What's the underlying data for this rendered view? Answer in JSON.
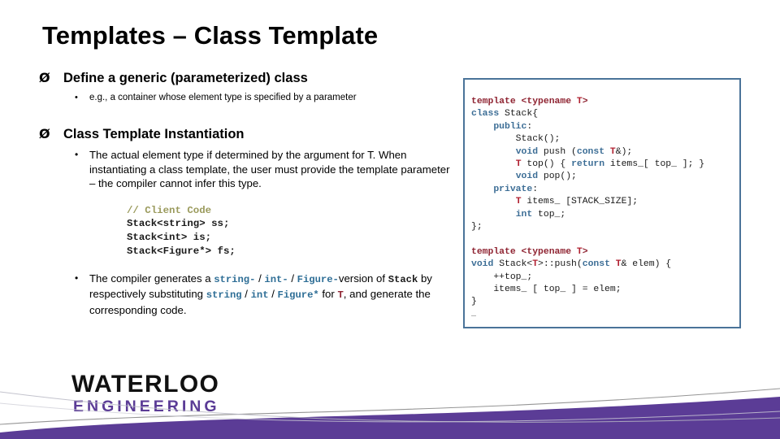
{
  "slide": {
    "title": "Templates – Class Template",
    "bullets": [
      {
        "marker": "Ø",
        "text": "Define a generic (parameterized) class",
        "sub": [
          {
            "marker": "•",
            "text": "e.g., a container whose element type is specified by a parameter"
          }
        ]
      },
      {
        "marker": "Ø",
        "text": "Class Template Instantiation",
        "sub": [
          {
            "marker": "•",
            "text": "The actual element type if determined by the argument for T. When instantiating a class template, the user must provide the template parameter – the compiler cannot infer this type."
          }
        ]
      }
    ],
    "client_code": {
      "comment": "// Client Code",
      "lines": [
        "Stack<string> ss;",
        "Stack<int> is;",
        "Stack<Figure*> fs;"
      ]
    },
    "compiler_bullet": {
      "marker": "•",
      "prefix": "The compiler generates a ",
      "type_a": "string-",
      "sep1": " / ",
      "type_b": "int-",
      "sep2": " / ",
      "type_c": "Figure-",
      "mid1": "version of ",
      "stack_token": "Stack",
      "mid2": " by respectively substituting",
      "sub_a": "string",
      "sep3": " / ",
      "sub_b": "int",
      "sep4": " / ",
      "sub_c": "Figure*",
      "mid3": " for ",
      "t_token": "T",
      "tail": ", and generate the corresponding code."
    },
    "code_box": {
      "lines": [
        [
          {
            "t": "template ",
            "c": "tmpl"
          },
          {
            "t": "<",
            "c": "tmpl"
          },
          {
            "t": "typename ",
            "c": "tmpl"
          },
          {
            "t": "T",
            "c": "tparam"
          },
          {
            "t": ">",
            "c": "tmpl"
          }
        ],
        [
          {
            "t": "class ",
            "c": "kw"
          },
          {
            "t": "Stack{",
            "c": "plain"
          }
        ],
        [
          {
            "t": "    ",
            "c": "plain"
          },
          {
            "t": "public",
            "c": "kw"
          },
          {
            "t": ":",
            "c": "plain"
          }
        ],
        [
          {
            "t": "        Stack();",
            "c": "plain"
          }
        ],
        [
          {
            "t": "        ",
            "c": "plain"
          },
          {
            "t": "void ",
            "c": "kw"
          },
          {
            "t": "push (",
            "c": "plain"
          },
          {
            "t": "const ",
            "c": "kw"
          },
          {
            "t": "T",
            "c": "tparam"
          },
          {
            "t": "&);",
            "c": "plain"
          }
        ],
        [
          {
            "t": "        ",
            "c": "plain"
          },
          {
            "t": "T",
            "c": "tparam"
          },
          {
            "t": " top() { ",
            "c": "plain"
          },
          {
            "t": "return ",
            "c": "kw"
          },
          {
            "t": "items_[ top_ ]; }",
            "c": "plain"
          }
        ],
        [
          {
            "t": "        ",
            "c": "plain"
          },
          {
            "t": "void ",
            "c": "kw"
          },
          {
            "t": "pop();",
            "c": "plain"
          }
        ],
        [
          {
            "t": "    ",
            "c": "plain"
          },
          {
            "t": "private",
            "c": "kw"
          },
          {
            "t": ":",
            "c": "plain"
          }
        ],
        [
          {
            "t": "        ",
            "c": "plain"
          },
          {
            "t": "T",
            "c": "tparam"
          },
          {
            "t": " items_ [STACK_SIZE];",
            "c": "plain"
          }
        ],
        [
          {
            "t": "        ",
            "c": "plain"
          },
          {
            "t": "int ",
            "c": "kw"
          },
          {
            "t": "top_;",
            "c": "plain"
          }
        ],
        [
          {
            "t": "};",
            "c": "plain"
          }
        ],
        [],
        [
          {
            "t": "template ",
            "c": "tmpl"
          },
          {
            "t": "<",
            "c": "tmpl"
          },
          {
            "t": "typename ",
            "c": "tmpl"
          },
          {
            "t": "T",
            "c": "tparam"
          },
          {
            "t": ">",
            "c": "tmpl"
          }
        ],
        [
          {
            "t": "void ",
            "c": "kw"
          },
          {
            "t": "Stack<",
            "c": "plain"
          },
          {
            "t": "T",
            "c": "tparam"
          },
          {
            "t": ">::push(",
            "c": "plain"
          },
          {
            "t": "const ",
            "c": "kw"
          },
          {
            "t": "T",
            "c": "tparam"
          },
          {
            "t": "& elem) {",
            "c": "plain"
          }
        ],
        [
          {
            "t": "    ++top_;",
            "c": "plain"
          }
        ],
        [
          {
            "t": "    items_ [ top_ ] = elem;",
            "c": "plain"
          }
        ],
        [
          {
            "t": "}",
            "c": "plain"
          }
        ],
        [
          {
            "t": "…",
            "c": "ell"
          }
        ]
      ]
    },
    "logo": {
      "line1": "WATERLOO",
      "line2": "ENGINEERING"
    },
    "colors": {
      "brand_purple": "#5b3c96",
      "code_border": "#4a7399",
      "keyword_blue": "#3d6e96",
      "template_red": "#8f2432",
      "tparam_red": "#b02030",
      "comment_green": "#9a9a5c",
      "inline_blue": "#2e6e96"
    }
  }
}
